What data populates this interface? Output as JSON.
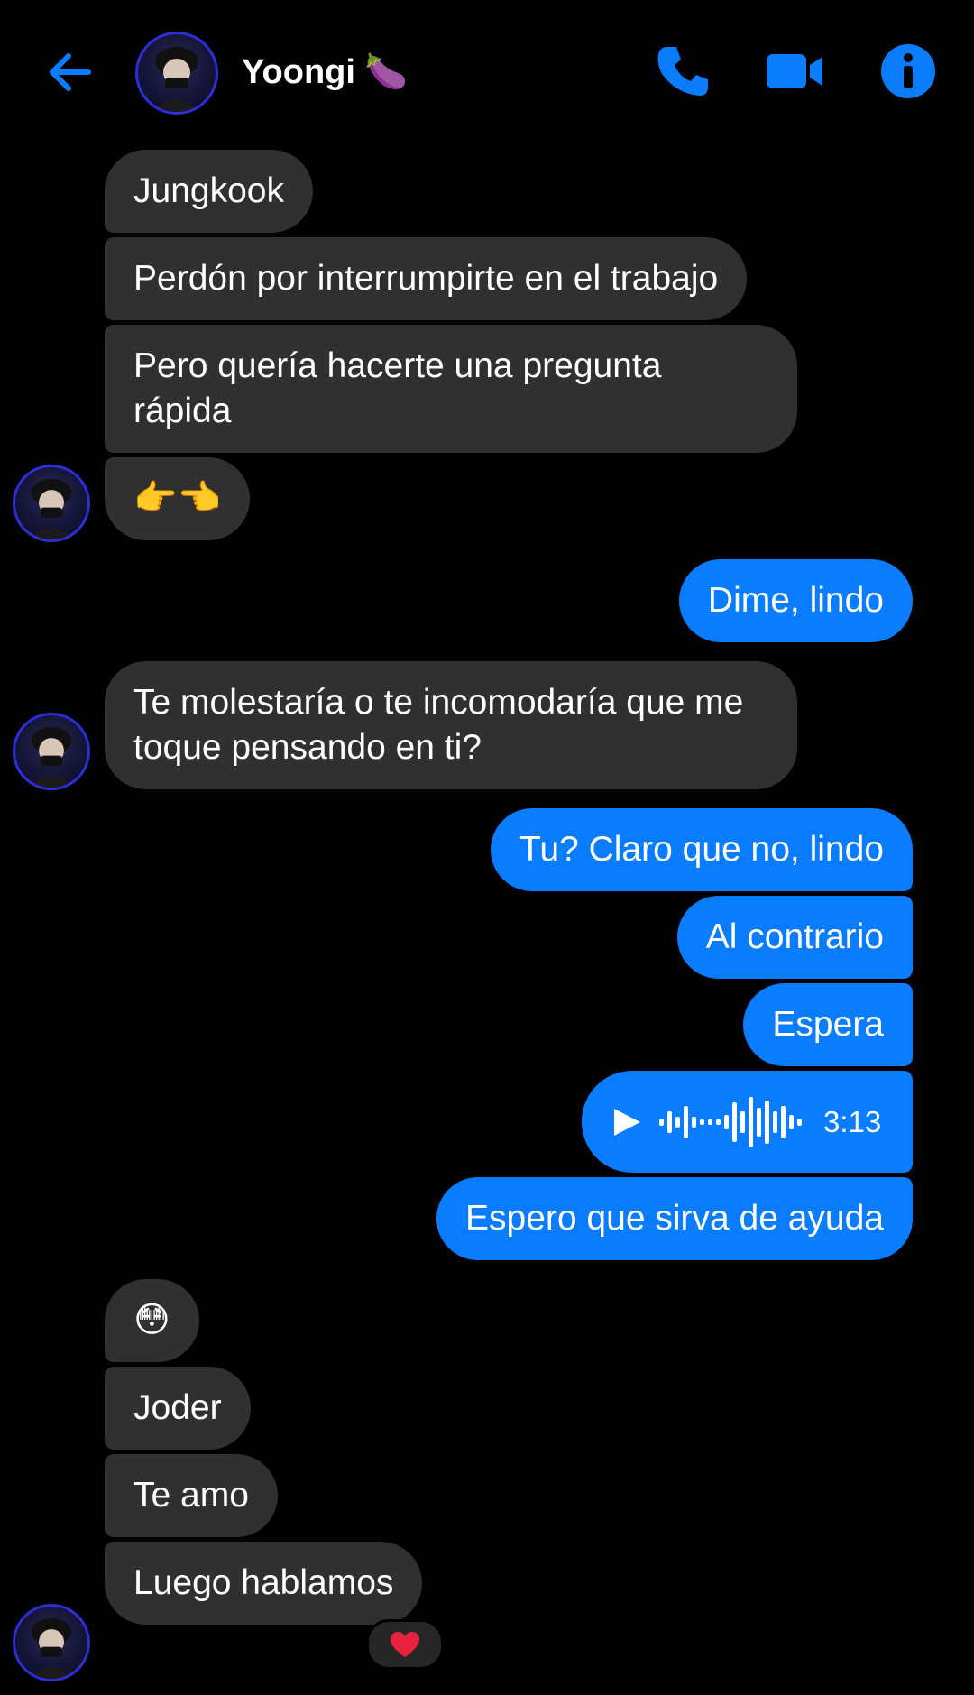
{
  "header": {
    "contact_name": "Yoongi 🍆"
  },
  "messages": [
    {
      "side": "in",
      "text": "Jungkook"
    },
    {
      "side": "in",
      "text": "Perdón por interrumpirte en el trabajo"
    },
    {
      "side": "in",
      "text": "Pero quería hacerte una pregunta rápida"
    },
    {
      "side": "in",
      "text": "👉👈"
    },
    {
      "side": "out",
      "text": "Dime, lindo"
    },
    {
      "side": "in",
      "text": "Te molestaría o te incomodaría que me toque pensando en ti?"
    },
    {
      "side": "out",
      "text": "Tu? Claro que no, lindo"
    },
    {
      "side": "out",
      "text": "Al contrario"
    },
    {
      "side": "out",
      "text": "Espera"
    },
    {
      "side": "out",
      "type": "audio",
      "duration": "3:13"
    },
    {
      "side": "out",
      "text": "Espero que sirva de ayuda"
    },
    {
      "side": "in",
      "text": "😳"
    },
    {
      "side": "in",
      "text": "Joder"
    },
    {
      "side": "in",
      "text": "Te amo"
    },
    {
      "side": "in",
      "text": "Luego hablamos",
      "reaction": "❤️"
    }
  ],
  "icons": {
    "back": "back-arrow-icon",
    "call": "phone-icon",
    "video": "video-camera-icon",
    "info": "info-icon",
    "play": "play-icon",
    "reaction": "heart-icon"
  },
  "colors": {
    "accent": "#0a7cff",
    "incoming_bubble": "#303030",
    "background": "#000000"
  }
}
